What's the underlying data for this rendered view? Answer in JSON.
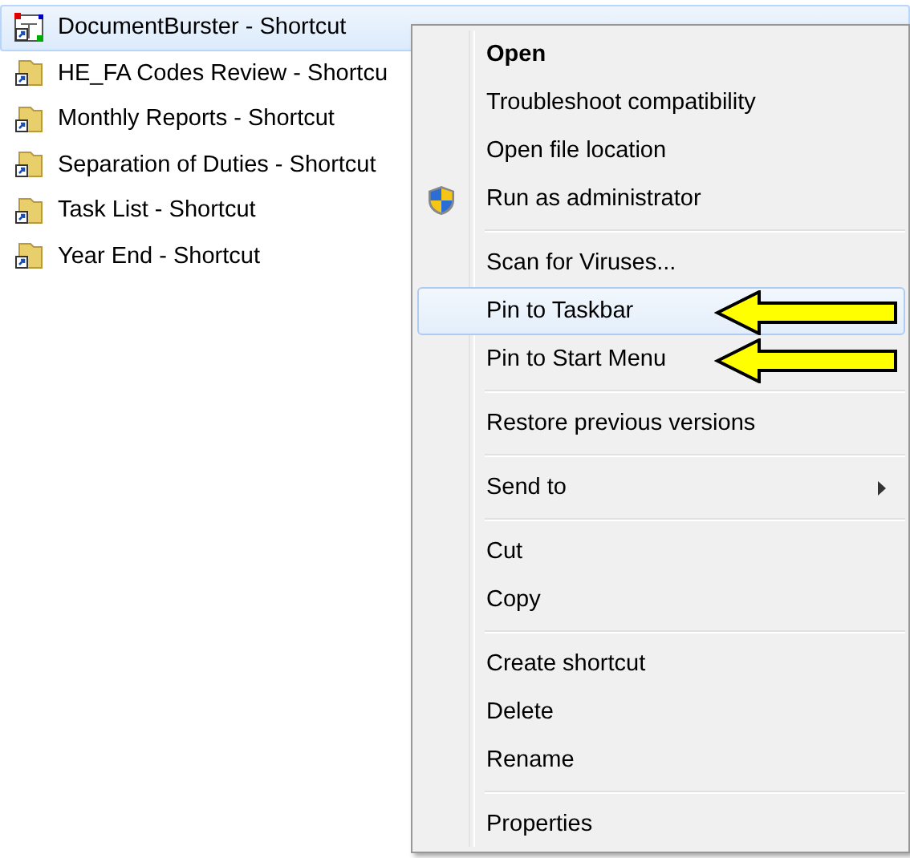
{
  "files": [
    {
      "name": "DocumentBurster - Shortcut",
      "kind": "app",
      "selected": true
    },
    {
      "name": "HE_FA Codes Review - Shortcu",
      "kind": "folder",
      "selected": false
    },
    {
      "name": "Monthly Reports - Shortcut",
      "kind": "folder",
      "selected": false
    },
    {
      "name": "Separation of Duties - Shortcut",
      "kind": "folder",
      "selected": false
    },
    {
      "name": "Task List - Shortcut",
      "kind": "folder",
      "selected": false
    },
    {
      "name": "Year End - Shortcut",
      "kind": "folder",
      "selected": false
    }
  ],
  "context_menu": {
    "groups": [
      {
        "items": [
          {
            "label": "Open",
            "default": true,
            "selected": false
          },
          {
            "label": "Troubleshoot compatibility",
            "default": false,
            "selected": false
          },
          {
            "label": "Open file location",
            "default": false,
            "selected": false
          },
          {
            "label": "Run as administrator",
            "default": false,
            "selected": false,
            "has_icon": true
          }
        ]
      },
      {
        "items": [
          {
            "label": "Scan for Viruses...",
            "default": false,
            "selected": false
          },
          {
            "label": "Pin to Taskbar",
            "default": false,
            "selected": true,
            "arrow": true
          },
          {
            "label": "Pin to Start Menu",
            "default": false,
            "selected": false,
            "arrow": true
          }
        ]
      },
      {
        "items": [
          {
            "label": "Restore previous versions",
            "default": false,
            "selected": false
          }
        ]
      },
      {
        "items": [
          {
            "label": "Send to",
            "default": false,
            "selected": false,
            "submenu": true
          }
        ]
      },
      {
        "items": [
          {
            "label": "Cut",
            "default": false,
            "selected": false
          },
          {
            "label": "Copy",
            "default": false,
            "selected": false
          }
        ]
      },
      {
        "items": [
          {
            "label": "Create shortcut",
            "default": false,
            "selected": false
          },
          {
            "label": "Delete",
            "default": false,
            "selected": false
          },
          {
            "label": "Rename",
            "default": false,
            "selected": false
          }
        ]
      },
      {
        "items": [
          {
            "label": "Properties",
            "default": false,
            "selected": false
          }
        ]
      }
    ]
  }
}
